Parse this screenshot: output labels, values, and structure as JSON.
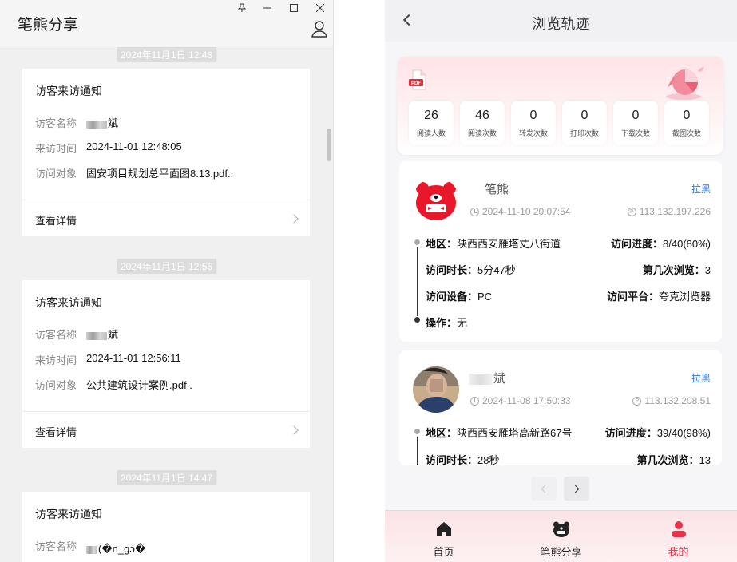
{
  "left": {
    "app_title": "笔熊分享",
    "window_controls": [
      "pin-icon",
      "minimize-icon",
      "maximize-icon",
      "close-icon"
    ],
    "notices": [
      {
        "timestamp": "2024年11月1日 12:48",
        "title": "访客来访通知",
        "visitor_label": "访客名称",
        "visitor_name": "斌",
        "time_label": "来访时间",
        "time_value": "2024-11-01 12:48:05",
        "object_label": "访问对象",
        "object_value": "固安项目规划总平面图8.13.pdf..",
        "detail_label": "查看详情"
      },
      {
        "timestamp": "2024年11月1日 12:56",
        "title": "访客来访通知",
        "visitor_label": "访客名称",
        "visitor_name": "斌",
        "time_label": "来访时间",
        "time_value": "2024-11-01 12:56:11",
        "object_label": "访问对象",
        "object_value": "公共建筑设计案例.pdf..",
        "detail_label": "查看详情"
      },
      {
        "timestamp": "2024年11月1日 14:47",
        "title": "访客来访通知",
        "visitor_label": "访客名称",
        "visitor_name": "(�n_gↄ�"
      }
    ]
  },
  "right": {
    "page_title": "浏览轨迹",
    "stats": [
      {
        "value": "26",
        "label": "阅读人数"
      },
      {
        "value": "46",
        "label": "阅读次数"
      },
      {
        "value": "0",
        "label": "转发次数"
      },
      {
        "value": "0",
        "label": "打印次数"
      },
      {
        "value": "0",
        "label": "下载次数"
      },
      {
        "value": "0",
        "label": "截图次数"
      }
    ],
    "visits": [
      {
        "name": "笔熊",
        "blacklist_label": "拉黑",
        "datetime": "2024-11-10 20:07:54",
        "ip": "113.132.197.226",
        "region_label": "地区：",
        "region": "陕西西安雁塔丈八街道",
        "progress_label": "访问进度：",
        "progress": "8/40(80%)",
        "duration_label": "访问时长：",
        "duration": "5分47秒",
        "nth_label": "第几次浏览：",
        "nth": "3",
        "device_label": "访问设备：",
        "device": "PC",
        "platform_label": "访问平台：",
        "platform": "夸克浏览器",
        "action_label": "操作：",
        "action": "无"
      },
      {
        "name": "斌",
        "blacklist_label": "拉黑",
        "datetime": "2024-11-08 17:50:33",
        "ip": "113.132.208.51",
        "region_label": "地区：",
        "region": "陕西西安雁塔高新路67号",
        "progress_label": "访问进度：",
        "progress": "39/40(98%)",
        "duration_label": "访问时长：",
        "duration": "28秒",
        "nth_label": "第几次浏览：",
        "nth": "13"
      }
    ],
    "tabs": [
      {
        "label": "首页",
        "icon": "home-icon",
        "active": false
      },
      {
        "label": "笔熊分享",
        "icon": "bear-icon",
        "active": false
      },
      {
        "label": "我的",
        "icon": "person-icon",
        "active": true
      }
    ]
  },
  "colors": {
    "accent": "#e8334a",
    "link": "#2f7ad6",
    "pdf_badge": "#e0303a"
  }
}
